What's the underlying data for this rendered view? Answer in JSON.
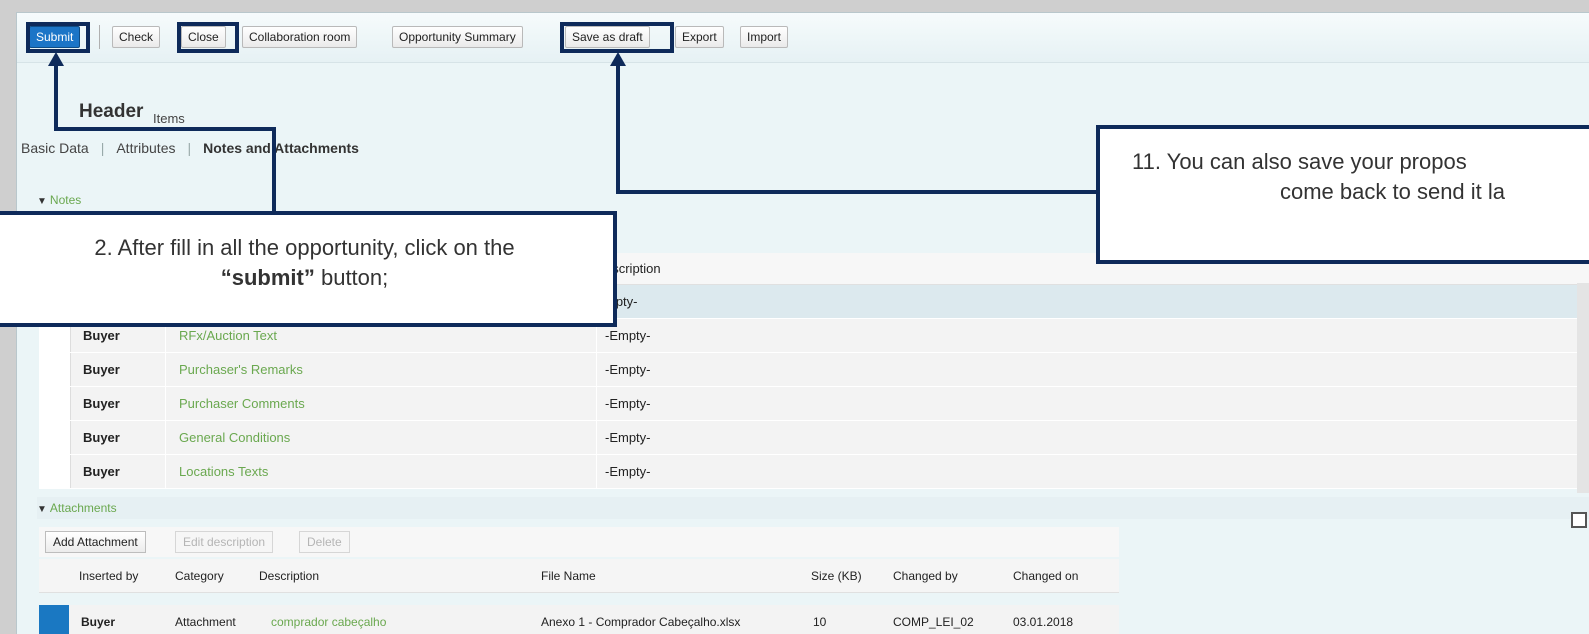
{
  "toolbar": {
    "submit": "Submit",
    "check": "Check",
    "close": "Close",
    "collaboration": "Collaboration room",
    "opportunity_summary": "Opportunity Summary",
    "save_draft": "Save as draft",
    "export": "Export",
    "import": "Import"
  },
  "tabs": {
    "header": "Header",
    "items": "Items"
  },
  "subtabs": {
    "basic": "Basic Data",
    "attributes": "Attributes",
    "notes": "Notes and Attachments"
  },
  "notes": {
    "title": "Notes",
    "col_description": "escription",
    "rows": [
      {
        "by": "",
        "type": "",
        "desc": "mpty-"
      },
      {
        "by": "Buyer",
        "type": "RFx/Auction Text",
        "desc": "-Empty-"
      },
      {
        "by": "Buyer",
        "type": "Purchaser's Remarks",
        "desc": "-Empty-"
      },
      {
        "by": "Buyer",
        "type": "Purchaser Comments",
        "desc": "-Empty-"
      },
      {
        "by": "Buyer",
        "type": "General Conditions",
        "desc": "-Empty-"
      },
      {
        "by": "Buyer",
        "type": "Locations Texts",
        "desc": "-Empty-"
      }
    ]
  },
  "attachments": {
    "title": "Attachments",
    "buttons": {
      "add": "Add Attachment",
      "edit": "Edit description",
      "delete": "Delete"
    },
    "columns": [
      "Inserted by",
      "Category",
      "Description",
      "File Name",
      "Size (KB)",
      "Changed by",
      "Changed on"
    ],
    "row": {
      "inserted_by": "Buyer",
      "category": "Attachment",
      "description": "comprador cabeçalho",
      "file_name": "Anexo 1 - Comprador Cabeçalho.xlsx",
      "size": "10",
      "changed_by": "COMP_LEI_02",
      "changed_on": "03.01.2018"
    }
  },
  "callouts": {
    "submit_line1": "2. After fill in all the opportunity, click on the",
    "submit_bold": "“submit”",
    "submit_tail": " button;",
    "draft_line1": "11. You can also save your propos",
    "draft_line2": "come back to send it la"
  },
  "colors": {
    "primary": "#1c75c7",
    "callout_border": "#0e2a5a",
    "link_green": "#6aa84f"
  }
}
